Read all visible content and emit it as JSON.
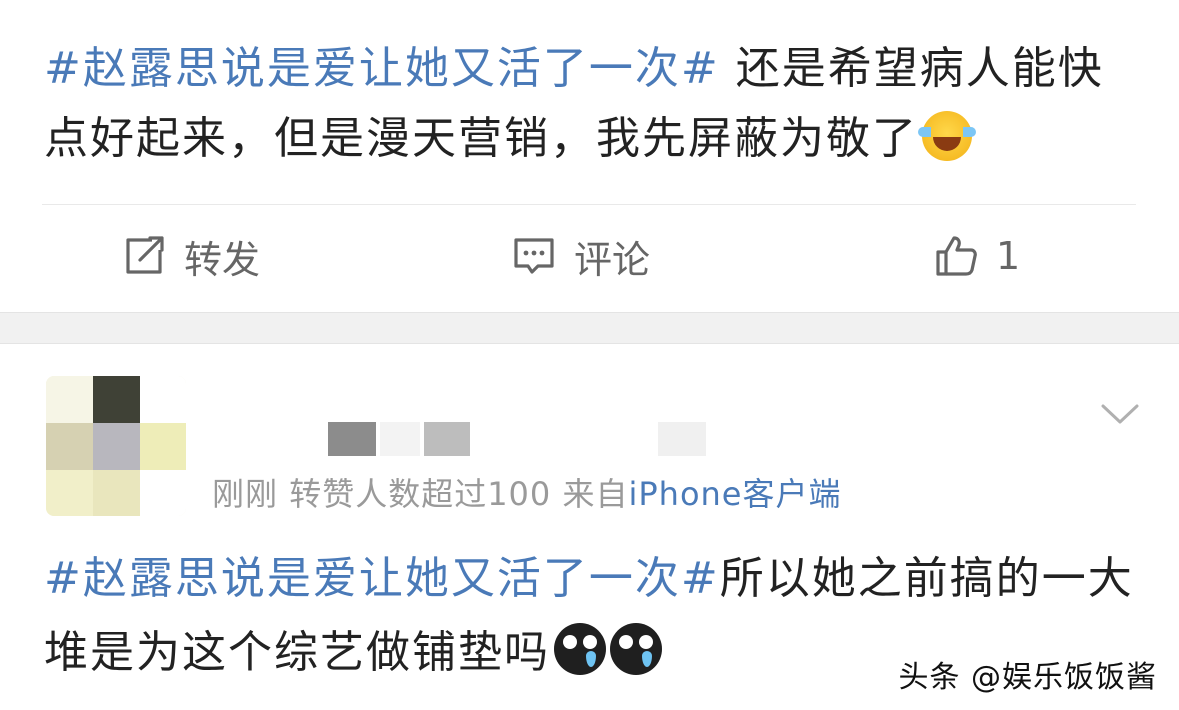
{
  "post1": {
    "hashtag": "#赵露思说是爱让她又活了一次#",
    "text": " 还是希望病人能快点好起来，但是漫天营销，我先屏蔽为敬了",
    "emoji": "laughing-tears-emoji",
    "actions": {
      "repost_label": "转发",
      "comment_label": "评论",
      "like_count": "1"
    }
  },
  "post2": {
    "timestamp": "刚刚",
    "like_summary": "转赞人数超过100",
    "source_prefix": "来自",
    "source": "iPhone客户端",
    "hashtag": "#赵露思说是爱让她又活了一次#",
    "text": "所以她之前搞的一大堆是为这个综艺做铺垫吗",
    "emojis": [
      "crying-emoji",
      "crying-emoji"
    ]
  },
  "watermark": "头条 @娱乐饭饭酱",
  "colors": {
    "hashtag": "#4a7ab8",
    "text": "#222222",
    "meta": "#9a9a9a",
    "separator": "#f1f1f1"
  }
}
